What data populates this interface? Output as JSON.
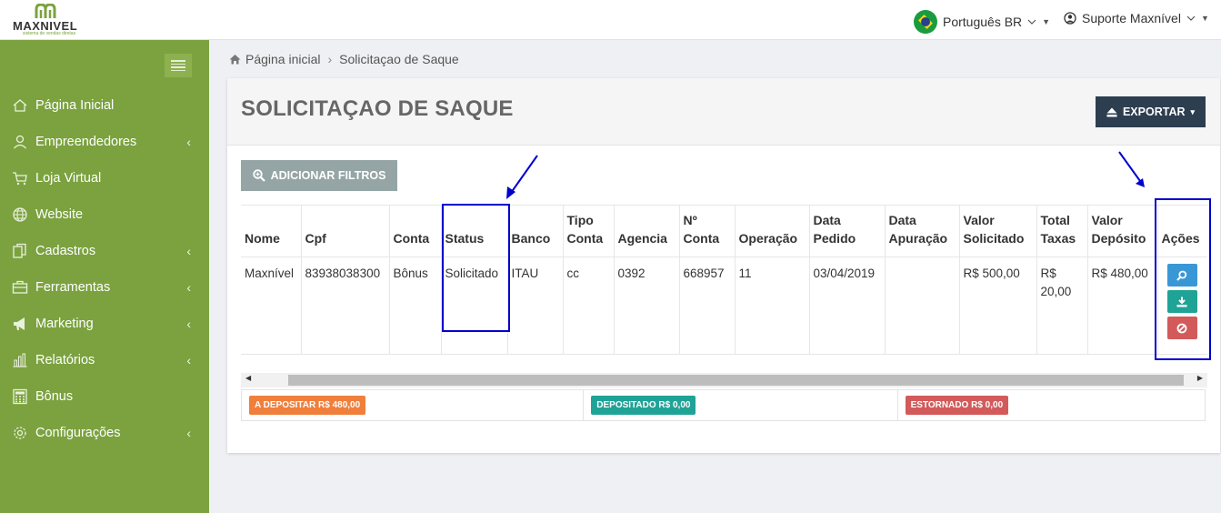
{
  "brand": {
    "name": "MAXNIVEL",
    "tagline": "sistema de vendas diretas"
  },
  "header": {
    "language": "Português BR",
    "user": "Suporte Maxnível"
  },
  "sidebar": {
    "items": [
      {
        "label": "Página Inicial",
        "icon": "home-icon",
        "submenu": false
      },
      {
        "label": "Empreendedores",
        "icon": "user-icon",
        "submenu": true
      },
      {
        "label": "Loja Virtual",
        "icon": "cart-icon",
        "submenu": false
      },
      {
        "label": "Website",
        "icon": "globe-icon",
        "submenu": false
      },
      {
        "label": "Cadastros",
        "icon": "documents-icon",
        "submenu": true
      },
      {
        "label": "Ferramentas",
        "icon": "toolbox-icon",
        "submenu": true
      },
      {
        "label": "Marketing",
        "icon": "megaphone-icon",
        "submenu": true
      },
      {
        "label": "Relatórios",
        "icon": "bar-chart-icon",
        "submenu": true
      },
      {
        "label": "Bônus",
        "icon": "calculator-icon",
        "submenu": false
      },
      {
        "label": "Configurações",
        "icon": "gear-icon",
        "submenu": true
      }
    ]
  },
  "breadcrumb": {
    "home": "Página inicial",
    "current": "Solicitaçao de Saque"
  },
  "page": {
    "title": "SOLICITAÇAO DE SAQUE",
    "export_label": "EXPORTAR",
    "filters_label": "ADICIONAR FILTROS"
  },
  "table": {
    "columns": [
      "Nome",
      "Cpf",
      "Conta",
      "Status",
      "Banco",
      "Tipo Conta",
      "Agencia",
      "Nº Conta",
      "Operação",
      "Data Pedido",
      "Data Apuração",
      "Valor Solicitado",
      "Total Taxas",
      "Valor Depósito",
      "Ações"
    ],
    "rows": [
      [
        "Maxnível",
        "83938038300",
        "Bônus",
        "Solicitado",
        "ITAU",
        "cc",
        "0392",
        "668957",
        "11",
        "03/04/2019",
        "",
        "R$ 500,00",
        "R$ 20,00",
        "R$ 480,00"
      ]
    ]
  },
  "totals": {
    "a_depositar": "A DEPOSITAR R$ 480,00",
    "depositado": "DEPOSITADO R$ 0,00",
    "estornado": "ESTORNADO R$ 0,00"
  },
  "colors": {
    "sidebar": "#7ba23f",
    "export_button": "#2c3e50",
    "badge_pending": "#f07f3c",
    "badge_deposited": "#1fa396",
    "badge_reversed": "#d35a5a",
    "annotation": "#0000cc"
  }
}
